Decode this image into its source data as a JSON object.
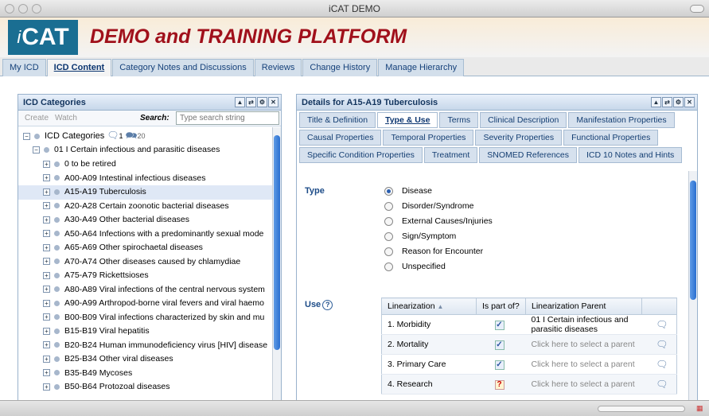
{
  "window": {
    "title": "iCAT DEMO"
  },
  "header": {
    "logo_text": "CAT",
    "logo_prefix": "i",
    "title": "DEMO and TRAINING PLATFORM"
  },
  "nav": {
    "tabs": [
      "My ICD",
      "ICD Content",
      "Category Notes and Discussions",
      "Reviews",
      "Change History",
      "Manage Hierarchy"
    ],
    "active": "ICD Content"
  },
  "left_panel": {
    "title": "ICD Categories",
    "create_label": "Create",
    "watch_label": "Watch",
    "search_label": "Search:",
    "search_placeholder": "Type search string",
    "root": {
      "label": "ICD Categories",
      "notes_count": "1",
      "discussions_count": "20"
    },
    "parent": "01 I Certain infectious and parasitic diseases",
    "items": [
      "0 to be retired",
      "A00-A09 Intestinal infectious diseases",
      "A15-A19 Tuberculosis",
      "A20-A28 Certain zoonotic bacterial diseases",
      "A30-A49 Other bacterial diseases",
      "A50-A64 Infections with a predominantly sexual mode",
      "A65-A69 Other spirochaetal diseases",
      "A70-A74 Other diseases caused by chlamydiae",
      "A75-A79 Rickettsioses",
      "A80-A89 Viral infections of the central nervous system",
      "A90-A99 Arthropod-borne viral fevers and viral haemo",
      "B00-B09 Viral infections characterized by skin and mu",
      "B15-B19 Viral hepatitis",
      "B20-B24 Human immunodeficiency virus [HIV] disease",
      "B25-B34 Other viral diseases",
      "B35-B49 Mycoses",
      "B50-B64 Protozoal diseases"
    ],
    "selected": "A15-A19 Tuberculosis"
  },
  "right_panel": {
    "title": "Details for A15-A19 Tuberculosis",
    "tab_rows": [
      [
        "Title & Definition",
        "Type & Use",
        "Terms",
        "Clinical Description",
        "Manifestation Properties"
      ],
      [
        "Causal Properties",
        "Temporal Properties",
        "Severity Properties",
        "Functional Properties"
      ],
      [
        "Specific Condition Properties",
        "Treatment",
        "SNOMED References",
        "ICD 10 Notes and Hints"
      ]
    ],
    "active_tab": "Type & Use",
    "type_label": "Type",
    "type_options": [
      "Disease",
      "Disorder/Syndrome",
      "External Causes/Injuries",
      "Sign/Symptom",
      "Reason for Encounter",
      "Unspecified"
    ],
    "type_selected": "Disease",
    "use_label": "Use",
    "use_table": {
      "headers": [
        "Linearization",
        "Is part of?",
        "Linearization Parent"
      ],
      "rows": [
        {
          "name": "1. Morbidity",
          "part_of": "checked",
          "parent": "01 I Certain infectious and parasitic diseases"
        },
        {
          "name": "2. Mortality",
          "part_of": "checked",
          "parent": "Click here to select a parent"
        },
        {
          "name": "3. Primary Care",
          "part_of": "checked",
          "parent": "Click here to select a parent"
        },
        {
          "name": "4. Research",
          "part_of": "unknown",
          "parent": "Click here to select a parent"
        }
      ]
    }
  },
  "colors": {
    "brand_title": "#a0101b",
    "logo_bg": "#1a6e92",
    "link": "#15417a"
  }
}
